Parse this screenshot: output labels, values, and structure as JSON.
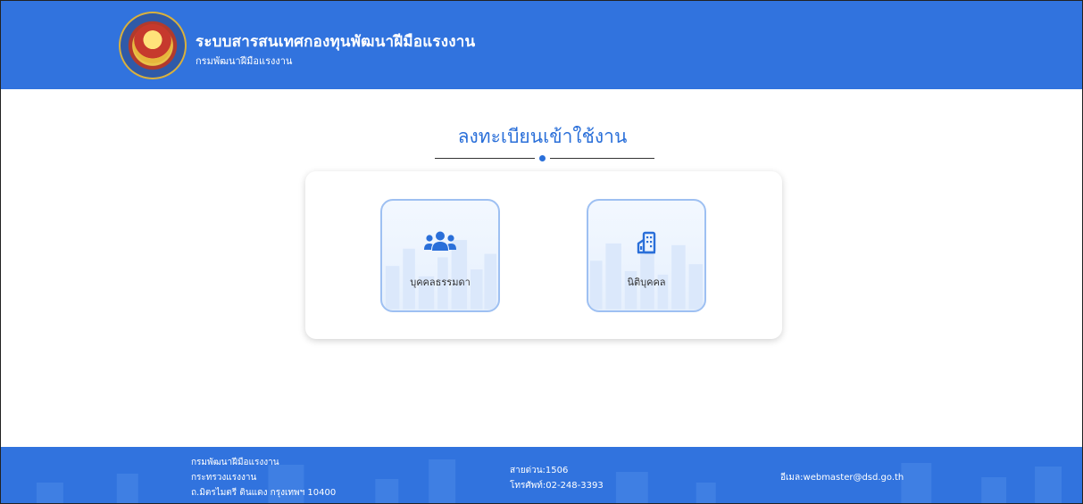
{
  "header": {
    "title": "ระบบสารสนเทศกองทุนพัฒนาฝีมือแรงงาน",
    "subtitle": "กรมพัฒนาฝีมือแรงงาน",
    "logo_icon": "department-seal-logo"
  },
  "main": {
    "title": "ลงทะเบียนเข้าใช้งาน",
    "options": [
      {
        "label": "บุคคลธรรมดา",
        "icon": "users-icon"
      },
      {
        "label": "นิติบุคคล",
        "icon": "building-icon"
      }
    ]
  },
  "footer": {
    "org": "กรมพัฒนาฝีมือแรงงาน",
    "ministry": "กระทรวงแรงงาน",
    "address": "ถ.มิตรไมตรี ดินแดง กรุงเทพฯ 10400",
    "hotline": "สายด่วน:1506",
    "phone": "โทรศัพท์:02-248-3393",
    "email": "อีเมล:webmaster@dsd.go.th"
  },
  "colors": {
    "brand_blue": "#3173de",
    "accent_blue": "#2a6fd9",
    "card_border": "#9ec0f2"
  }
}
